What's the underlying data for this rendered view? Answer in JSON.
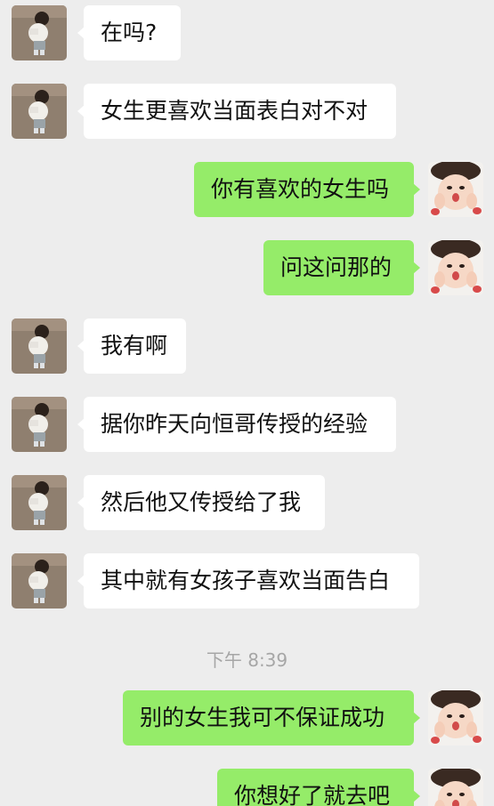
{
  "messages": [
    {
      "side": "left",
      "text": "在吗?"
    },
    {
      "side": "left",
      "text": "女生更喜欢当面表白对不对"
    },
    {
      "side": "right",
      "text": "你有喜欢的女生吗"
    },
    {
      "side": "right",
      "text": "问这问那的"
    },
    {
      "side": "left",
      "text": "我有啊"
    },
    {
      "side": "left",
      "text": "据你昨天向恒哥传授的经验"
    },
    {
      "side": "left",
      "text": "然后他又传授给了我"
    },
    {
      "side": "left",
      "text": "其中就有女孩子喜欢当面告白"
    },
    {
      "side": "right",
      "text": "别的女生我可不保证成功"
    },
    {
      "side": "right",
      "text": "你想好了就去吧"
    }
  ],
  "timestamp": "下午 8:39",
  "colors": {
    "background": "#ededed",
    "incoming_bubble": "#ffffff",
    "outgoing_bubble": "#95ec69",
    "timestamp_text": "#a6a6a6"
  },
  "icons": {
    "incoming_avatar": "avatar-child-back",
    "outgoing_avatar": "avatar-baby-face"
  }
}
